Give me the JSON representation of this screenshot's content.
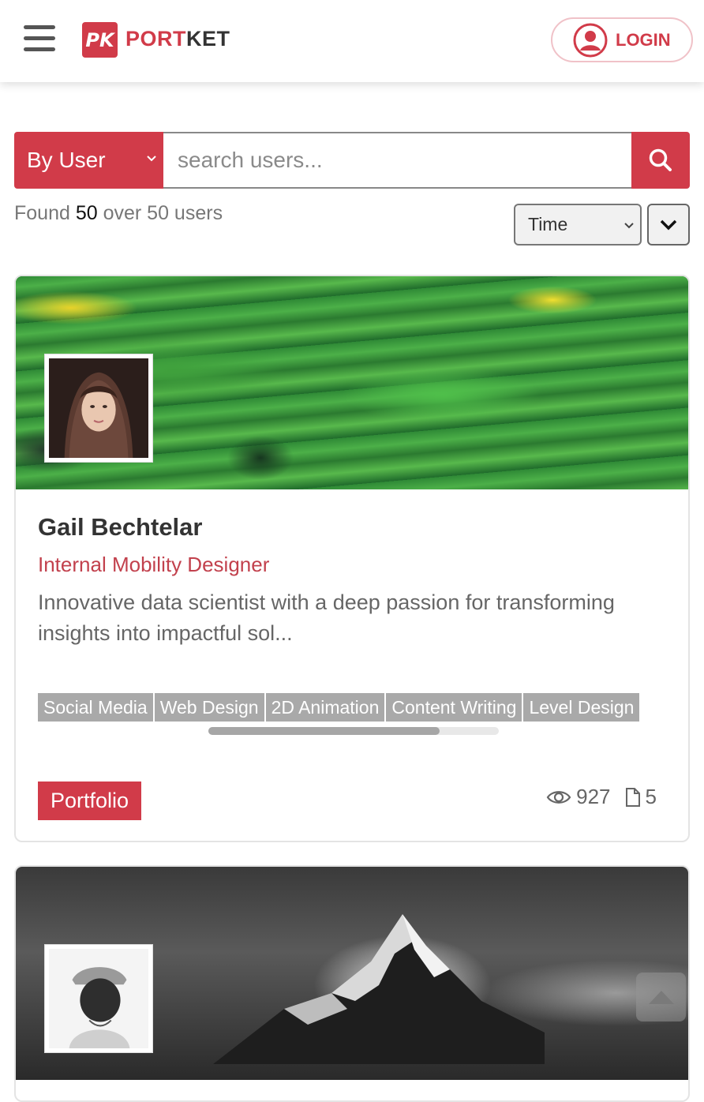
{
  "header": {
    "logo_mark": "PK",
    "brand_part1": "PORT",
    "brand_part2": "KET",
    "login_label": "LOGIN"
  },
  "search": {
    "filter_selected": "By User",
    "placeholder": "search users...",
    "value": ""
  },
  "results": {
    "prefix": "Found ",
    "count": "50",
    "suffix": " over 50 users",
    "sort_selected": "Time"
  },
  "cards": [
    {
      "name": "Gail Bechtelar",
      "role": "Internal Mobility Designer",
      "bio": "Innovative data scientist with a deep passion for transforming insights into impactful sol...",
      "tags": [
        "Social Media",
        "Web Design",
        "2D Animation",
        "Content Writing",
        "Level Design"
      ],
      "tag_scroll_fraction": 0.8,
      "portfolio_label": "Portfolio",
      "views": "927",
      "documents": "5"
    }
  ],
  "colors": {
    "brand": "#d13b49",
    "brand_light": "#f0c2c8",
    "tag_bg": "#a9a9a9",
    "text_muted": "#666666"
  },
  "icons": {
    "menu": "hamburger-icon",
    "user": "user-circle-icon",
    "search": "search-icon",
    "views": "eye-icon",
    "documents": "document-icon",
    "scroll_top": "caret-up-icon"
  }
}
